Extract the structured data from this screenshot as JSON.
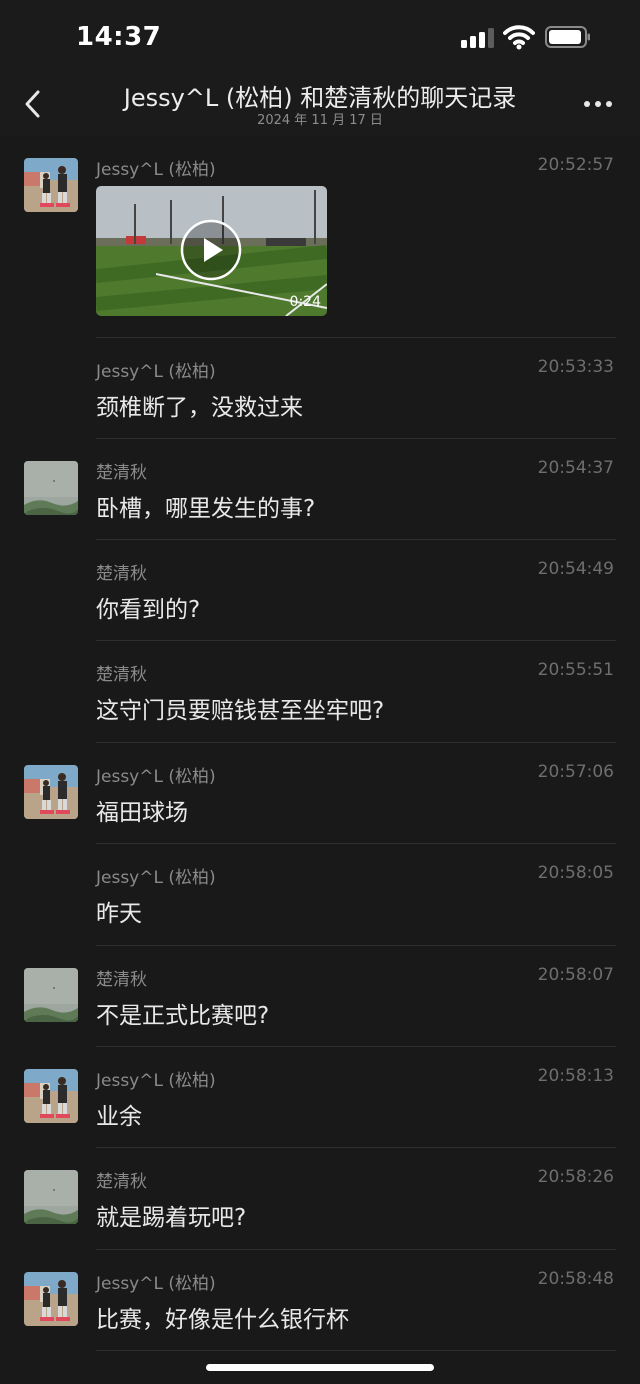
{
  "status": {
    "time": "14:37",
    "battery_icon": "battery-icon",
    "wifi_icon": "wifi-icon",
    "signal_icon": "cellular-signal-icon"
  },
  "header": {
    "title": "Jessy^L (松柏) 和楚清秋的聊天记录",
    "subtitle": "2024 年 11 月 17 日",
    "back_icon": "chevron-left-icon",
    "more_icon": "more-icon"
  },
  "messages": [
    {
      "sender": "Jessy^L (松柏)",
      "time": "20:52:57",
      "text": "",
      "type": "video",
      "duration": "0:24",
      "show_avatar": true,
      "avatar": "jessy"
    },
    {
      "sender": "Jessy^L (松柏)",
      "time": "20:53:33",
      "text": "颈椎断了，没救过来",
      "type": "text",
      "show_avatar": false,
      "avatar": "jessy"
    },
    {
      "sender": "楚清秋",
      "time": "20:54:37",
      "text": "卧槽，哪里发生的事?",
      "type": "text",
      "show_avatar": true,
      "avatar": "chu"
    },
    {
      "sender": "楚清秋",
      "time": "20:54:49",
      "text": "你看到的?",
      "type": "text",
      "show_avatar": false,
      "avatar": "chu"
    },
    {
      "sender": "楚清秋",
      "time": "20:55:51",
      "text": "这守门员要赔钱甚至坐牢吧?",
      "type": "text",
      "show_avatar": false,
      "avatar": "chu"
    },
    {
      "sender": "Jessy^L (松柏)",
      "time": "20:57:06",
      "text": "福田球场",
      "type": "text",
      "show_avatar": true,
      "avatar": "jessy"
    },
    {
      "sender": "Jessy^L (松柏)",
      "time": "20:58:05",
      "text": "昨天",
      "type": "text",
      "show_avatar": false,
      "avatar": "jessy"
    },
    {
      "sender": "楚清秋",
      "time": "20:58:07",
      "text": "不是正式比赛吧?",
      "type": "text",
      "show_avatar": true,
      "avatar": "chu"
    },
    {
      "sender": "Jessy^L (松柏)",
      "time": "20:58:13",
      "text": "业余",
      "type": "text",
      "show_avatar": true,
      "avatar": "jessy"
    },
    {
      "sender": "楚清秋",
      "time": "20:58:26",
      "text": "就是踢着玩吧?",
      "type": "text",
      "show_avatar": true,
      "avatar": "chu"
    },
    {
      "sender": "Jessy^L (松柏)",
      "time": "20:58:48",
      "text": "比赛，好像是什么银行杯",
      "type": "text",
      "show_avatar": true,
      "avatar": "jessy"
    }
  ],
  "colors": {
    "background": "#191919",
    "header_bg": "#1b1b1b",
    "divider": "#2e2e2e",
    "sender_text": "#8a8a8a",
    "time_text": "#6e6e6e",
    "message_text": "#e8e8e8"
  }
}
